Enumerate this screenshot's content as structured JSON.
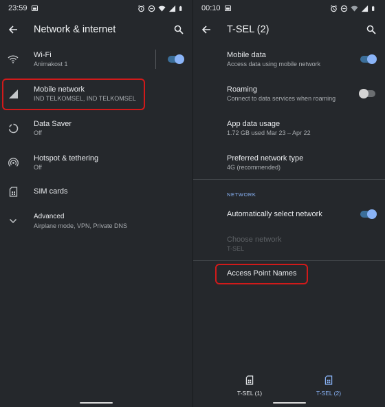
{
  "left_screen": {
    "status": {
      "time": "23:59"
    },
    "appbar": {
      "title": "Network & internet"
    },
    "items": [
      {
        "title": "Wi-Fi",
        "subtitle": "Animakost 1",
        "icon": "wifi-icon"
      },
      {
        "title": "Mobile network",
        "subtitle": "IND TELKOMSEL, IND TELKOMSEL",
        "icon": "signal-icon"
      },
      {
        "title": "Data Saver",
        "subtitle": "Off",
        "icon": "data-saver-icon"
      },
      {
        "title": "Hotspot & tethering",
        "subtitle": "Off",
        "icon": "hotspot-icon"
      },
      {
        "title": "SIM cards",
        "subtitle": "",
        "icon": "sim-card-icon"
      },
      {
        "title": "Advanced",
        "subtitle": "Airplane mode, VPN, Private DNS",
        "icon": "chevron-down-icon"
      }
    ],
    "wifi_enabled": true
  },
  "right_screen": {
    "status": {
      "time": "00:10"
    },
    "appbar": {
      "title": "T-SEL (2)"
    },
    "items": [
      {
        "title": "Mobile data",
        "subtitle": "Access data using mobile network",
        "toggle": true
      },
      {
        "title": "Roaming",
        "subtitle": "Connect to data services when roaming",
        "toggle": false
      },
      {
        "title": "App data usage",
        "subtitle": "1.72 GB used Mar 23 – Apr 22"
      },
      {
        "title": "Preferred network type",
        "subtitle": "4G (recommended)"
      }
    ],
    "section_header": "NETWORK",
    "network_items": [
      {
        "title": "Automatically select network",
        "subtitle": "",
        "toggle": true
      },
      {
        "title": "Choose network",
        "subtitle": "T-SEL",
        "disabled": true
      }
    ],
    "apn": {
      "title": "Access Point Names"
    },
    "tabs": [
      {
        "label": "T-SEL (1)",
        "active": false
      },
      {
        "label": "T-SEL (2)",
        "active": true
      }
    ]
  },
  "colors": {
    "accent": "#8ab4f8",
    "highlight": "#d11a1a",
    "background": "#25282c"
  }
}
